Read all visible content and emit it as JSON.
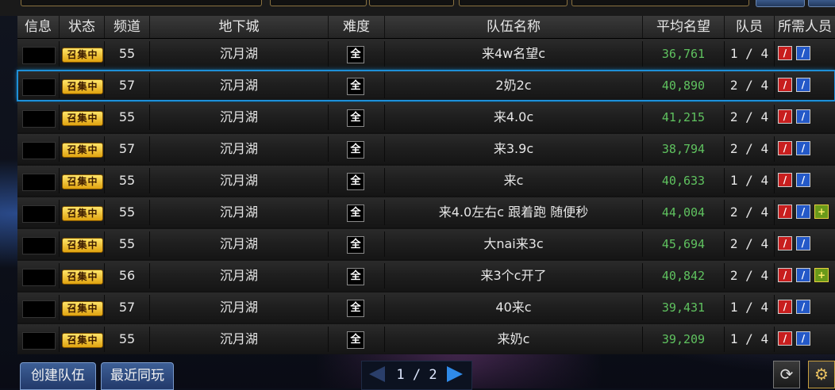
{
  "headers": {
    "info": "信息",
    "status": "状态",
    "channel": "频道",
    "dungeon": "地下城",
    "difficulty": "难度",
    "team_name": "队伍名称",
    "avg_fame": "平均名望",
    "members": "队员",
    "needed": "所需人员"
  },
  "rows": [
    {
      "status": "召集中",
      "channel": "55",
      "dungeon": "沉月湖",
      "difficulty": "全",
      "team_name": "来4w名望c",
      "avg_fame": "36,761",
      "members": "1 / 4",
      "roles": [
        "red",
        "blue"
      ]
    },
    {
      "status": "召集中",
      "channel": "57",
      "dungeon": "沉月湖",
      "difficulty": "全",
      "team_name": "2奶2c",
      "avg_fame": "40,890",
      "members": "2 / 4",
      "roles": [
        "red",
        "blue"
      ]
    },
    {
      "status": "召集中",
      "channel": "55",
      "dungeon": "沉月湖",
      "difficulty": "全",
      "team_name": "来4.0c",
      "avg_fame": "41,215",
      "members": "2 / 4",
      "roles": [
        "red",
        "blue"
      ]
    },
    {
      "status": "召集中",
      "channel": "57",
      "dungeon": "沉月湖",
      "difficulty": "全",
      "team_name": "来3.9c",
      "avg_fame": "38,794",
      "members": "2 / 4",
      "roles": [
        "red",
        "blue"
      ]
    },
    {
      "status": "召集中",
      "channel": "55",
      "dungeon": "沉月湖",
      "difficulty": "全",
      "team_name": "来c",
      "avg_fame": "40,633",
      "members": "1 / 4",
      "roles": [
        "red",
        "blue"
      ]
    },
    {
      "status": "召集中",
      "channel": "55",
      "dungeon": "沉月湖",
      "difficulty": "全",
      "team_name": "来4.0左右c 跟着跑 随便秒",
      "avg_fame": "44,004",
      "members": "2 / 4",
      "roles": [
        "red",
        "blue",
        "gold"
      ]
    },
    {
      "status": "召集中",
      "channel": "55",
      "dungeon": "沉月湖",
      "difficulty": "全",
      "team_name": "大nai来3c",
      "avg_fame": "45,694",
      "members": "2 / 4",
      "roles": [
        "red",
        "blue"
      ]
    },
    {
      "status": "召集中",
      "channel": "56",
      "dungeon": "沉月湖",
      "difficulty": "全",
      "team_name": "来3个c开了",
      "avg_fame": "40,842",
      "members": "2 / 4",
      "roles": [
        "red",
        "blue",
        "gold"
      ]
    },
    {
      "status": "召集中",
      "channel": "57",
      "dungeon": "沉月湖",
      "difficulty": "全",
      "team_name": "40来c",
      "avg_fame": "39,431",
      "members": "1 / 4",
      "roles": [
        "red",
        "blue"
      ]
    },
    {
      "status": "召集中",
      "channel": "55",
      "dungeon": "沉月湖",
      "difficulty": "全",
      "team_name": "来奶c",
      "avg_fame": "39,209",
      "members": "1 / 4",
      "roles": [
        "red",
        "blue"
      ]
    }
  ],
  "selected_row": 1,
  "bottom": {
    "create_team": "创建队伍",
    "recent_play": "最近同玩",
    "page": "1 / 2"
  },
  "colors": {
    "fame": "#5fc25f",
    "selected_outline": "#1e90d8",
    "badge": "#e0a310"
  },
  "icons": {
    "role_red": "sword-red-icon",
    "role_blue": "sword-blue-icon",
    "role_gold": "plus-gold-icon",
    "refresh": "refresh-icon",
    "settings": "gear-icon"
  }
}
